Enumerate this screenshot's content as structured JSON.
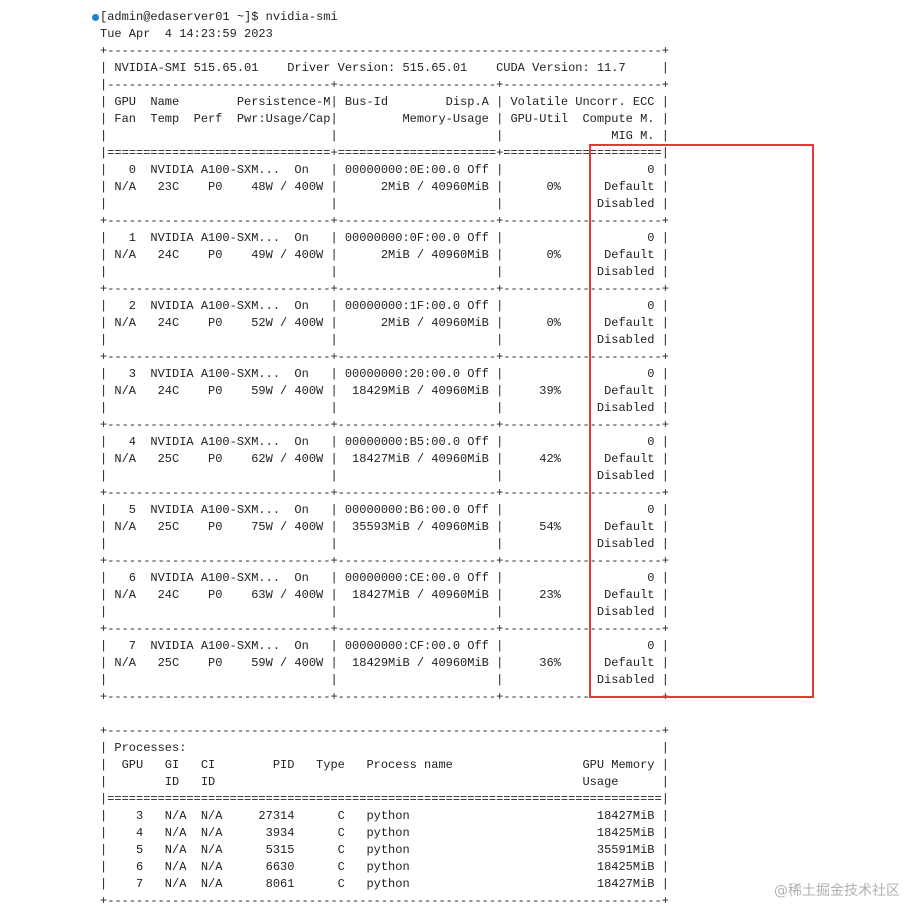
{
  "terminal": {
    "lines": [
      "[admin@edaserver01 ~]$ nvidia-smi",
      "Tue Apr  4 14:23:59 2023",
      "+-----------------------------------------------------------------------------+",
      "| NVIDIA-SMI 515.65.01    Driver Version: 515.65.01    CUDA Version: 11.7     |",
      "|-------------------------------+----------------------+----------------------+",
      "| GPU  Name        Persistence-M| Bus-Id        Disp.A | Volatile Uncorr. ECC |",
      "| Fan  Temp  Perf  Pwr:Usage/Cap|         Memory-Usage | GPU-Util  Compute M. |",
      "|                               |                      |               MIG M. |",
      "|===============================+======================+======================|",
      "|   0  NVIDIA A100-SXM...  On   | 00000000:0E:00.0 Off |                    0 |",
      "| N/A   23C    P0    48W / 400W |      2MiB / 40960MiB |      0%      Default |",
      "|                               |                      |             Disabled |",
      "+-------------------------------+----------------------+----------------------+",
      "|   1  NVIDIA A100-SXM...  On   | 00000000:0F:00.0 Off |                    0 |",
      "| N/A   24C    P0    49W / 400W |      2MiB / 40960MiB |      0%      Default |",
      "|                               |                      |             Disabled |",
      "+-------------------------------+----------------------+----------------------+",
      "|   2  NVIDIA A100-SXM...  On   | 00000000:1F:00.0 Off |                    0 |",
      "| N/A   24C    P0    52W / 400W |      2MiB / 40960MiB |      0%      Default |",
      "|                               |                      |             Disabled |",
      "+-------------------------------+----------------------+----------------------+",
      "|   3  NVIDIA A100-SXM...  On   | 00000000:20:00.0 Off |                    0 |",
      "| N/A   24C    P0    59W / 400W |  18429MiB / 40960MiB |     39%      Default |",
      "|                               |                      |             Disabled |",
      "+-------------------------------+----------------------+----------------------+",
      "|   4  NVIDIA A100-SXM...  On   | 00000000:B5:00.0 Off |                    0 |",
      "| N/A   25C    P0    62W / 400W |  18427MiB / 40960MiB |     42%      Default |",
      "|                               |                      |             Disabled |",
      "+-------------------------------+----------------------+----------------------+",
      "|   5  NVIDIA A100-SXM...  On   | 00000000:B6:00.0 Off |                    0 |",
      "| N/A   25C    P0    75W / 400W |  35593MiB / 40960MiB |     54%      Default |",
      "|                               |                      |             Disabled |",
      "+-------------------------------+----------------------+----------------------+",
      "|   6  NVIDIA A100-SXM...  On   | 00000000:CE:00.0 Off |                    0 |",
      "| N/A   24C    P0    63W / 400W |  18427MiB / 40960MiB |     23%      Default |",
      "|                               |                      |             Disabled |",
      "+-------------------------------+----------------------+----------------------+",
      "|   7  NVIDIA A100-SXM...  On   | 00000000:CF:00.0 Off |                    0 |",
      "| N/A   25C    P0    59W / 400W |  18429MiB / 40960MiB |     36%      Default |",
      "|                               |                      |             Disabled |",
      "+-------------------------------+----------------------+----------------------+",
      "",
      "+-----------------------------------------------------------------------------+",
      "| Processes:                                                                  |",
      "|  GPU   GI   CI        PID   Type   Process name                  GPU Memory |",
      "|        ID   ID                                                   Usage      |",
      "|=============================================================================|",
      "|    3   N/A  N/A     27314      C   python                          18427MiB |",
      "|    4   N/A  N/A      3934      C   python                          18425MiB |",
      "|    5   N/A  N/A      5315      C   python                          35591MiB |",
      "|    6   N/A  N/A      6630      C   python                          18425MiB |",
      "|    7   N/A  N/A      8061      C   python                          18427MiB |",
      "+-----------------------------------------------------------------------------+"
    ]
  },
  "watermark": "@稀土掘金技术社区",
  "colors": {
    "highlight": "#e53935",
    "prompt_dot": "#1a85c8"
  }
}
